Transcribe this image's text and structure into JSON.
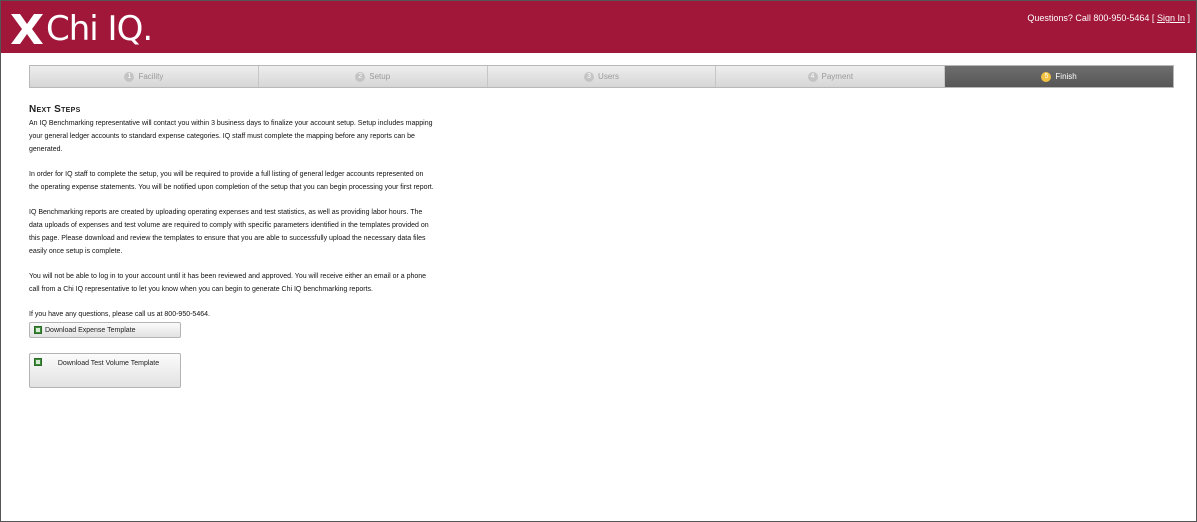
{
  "header": {
    "logo_text": "Chi IQ.",
    "contact_text": "Questions? Call 800-950-5464 [",
    "sign_in_label": "Sign In",
    "contact_close": "]",
    "brand_color": "#a0173a"
  },
  "steps": [
    {
      "number": "1",
      "label": "Facility",
      "active": false
    },
    {
      "number": "2",
      "label": "Setup",
      "active": false
    },
    {
      "number": "3",
      "label": "Users",
      "active": false
    },
    {
      "number": "4",
      "label": "Payment",
      "active": false
    },
    {
      "number": "5",
      "label": "Finish",
      "active": true
    }
  ],
  "content": {
    "title": "Next Steps",
    "paragraphs": [
      "An IQ Benchmarking representative will contact you within 3 business days to finalize your account setup. Setup includes mapping your general ledger accounts to standard expense categories. IQ staff must complete the mapping before any reports can be generated.",
      "In order for IQ staff to complete the setup, you will be required to provide a full listing of general ledger accounts represented on the operating expense statements. You will be notified upon completion of the setup that you can begin processing your first report.",
      "IQ Benchmarking reports are created by uploading operating expenses and test statistics, as well as providing labor hours. The data uploads of expenses and test volume are required to comply with specific parameters identified in the templates provided on this page. Please download and review the templates to ensure that you are able to successfully upload the necessary data files easily once setup is complete.",
      "You will not be able to log in to your account until it has been reviewed and approved. You will receive either an email or a phone call from a Chi IQ representative to let you know when you can begin to generate Chi IQ benchmarking reports.",
      "If you have any questions, please call us at 800-950-5464."
    ],
    "download_expense_label": "Download Expense Template",
    "download_test_volume_label": "Download Test Volume Template"
  }
}
